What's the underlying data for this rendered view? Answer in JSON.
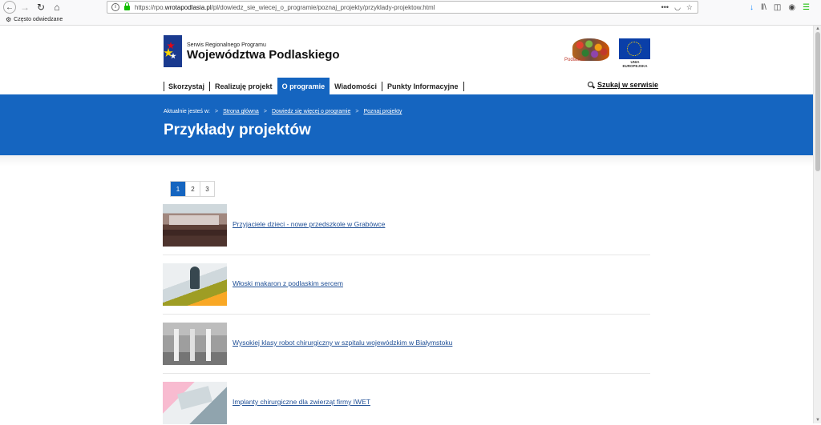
{
  "browser": {
    "url_prefix": "https://rpo.",
    "url_domain": "wrotapodlasia.pl",
    "url_path": "/pl/dowiedz_sie_wiecej_o_programie/poznaj_projekty/przyklady-projektow.html",
    "info_icon": "i",
    "more_icon": "•••",
    "bookmarks_item": "Często odwiedzane"
  },
  "header": {
    "logo_small": "Serwis Regionalnego Programu",
    "logo_big": "Województwa Podlaskiego",
    "podlaskie_label": "Podlaskie",
    "eu_label": "UNIA EUROPEJSKA"
  },
  "nav": {
    "items": [
      "Skorzystaj",
      "Realizuję projekt",
      "O programie",
      "Wiadomości",
      "Punkty Informacyjne"
    ],
    "active_index": 2,
    "search_label": "Szukaj w serwisie"
  },
  "hero": {
    "breadcrumb_lead": "Aktualnie jesteś w:",
    "breadcrumb_sep": ">",
    "breadcrumbs": [
      "Strona główna",
      "Dowiedz się więcej o programie",
      "Poznaj projekty"
    ],
    "title": "Przykłady projektów",
    "color": "#1565c0"
  },
  "pagination": {
    "pages": [
      "1",
      "2",
      "3"
    ],
    "current": "1"
  },
  "projects": [
    {
      "title": "Przyjaciele dzieci - nowe przedszkole w Grabówce"
    },
    {
      "title": "Włoski makaron z podlaskim sercem"
    },
    {
      "title": "Wysokiej klasy robot chirurgiczny w szpitalu wojewódzkim w Białymstoku"
    },
    {
      "title": "Implanty chirurgiczne dla zwierząt firmy IWET"
    }
  ]
}
